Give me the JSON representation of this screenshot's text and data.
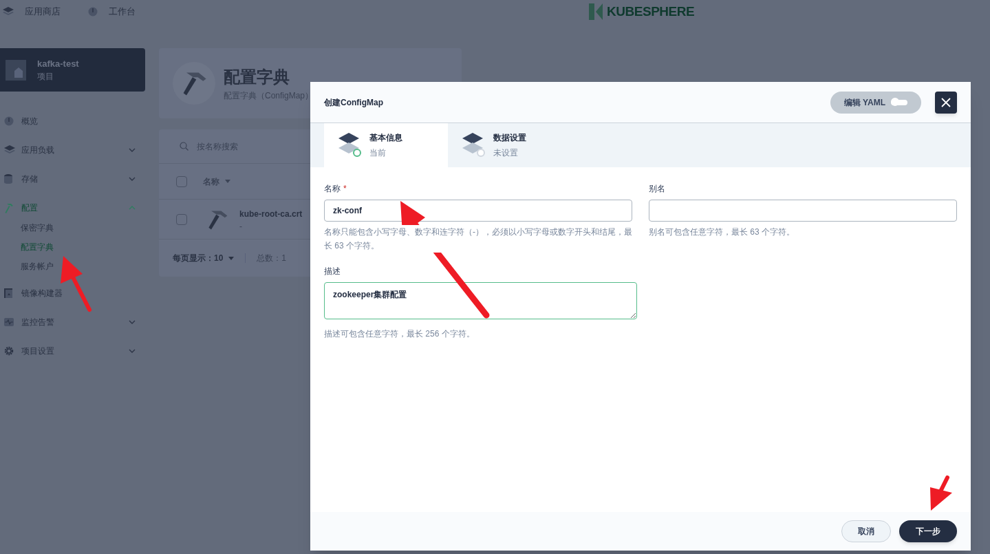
{
  "top_nav": [
    {
      "label": "应用商店",
      "kind": "store"
    },
    {
      "label": "工作台",
      "kind": "dashboard"
    }
  ],
  "logo": {
    "text": "KUBESPHERE"
  },
  "sidebar": {
    "project": {
      "name": "kafka-test",
      "type": "项目"
    },
    "items": [
      {
        "label": "概览",
        "kind": "link",
        "selected": false
      },
      {
        "label": "应用负载",
        "kind": "group",
        "selected": false,
        "expanded": false
      },
      {
        "label": "存储",
        "kind": "group",
        "selected": false,
        "expanded": false
      },
      {
        "label": "配置",
        "kind": "group",
        "selected": true,
        "expanded": true,
        "children": [
          {
            "label": "保密字典",
            "selected": false
          },
          {
            "label": "配置字典",
            "selected": true
          },
          {
            "label": "服务帐户",
            "selected": false
          }
        ]
      },
      {
        "label": "镜像构建器",
        "kind": "link",
        "selected": false
      },
      {
        "label": "监控告警",
        "kind": "group",
        "selected": false,
        "expanded": false
      },
      {
        "label": "项目设置",
        "kind": "group",
        "selected": false,
        "expanded": false
      }
    ]
  },
  "page_header": {
    "title": "配置字典",
    "subtitle": "配置字典（ConfigMap）"
  },
  "search": {
    "placeholder": "按名称搜索"
  },
  "table": {
    "select_all": {
      "checked": false
    },
    "columns": [
      {
        "label": "名称"
      }
    ],
    "rows": [
      {
        "name": "kube-root-ca.crt",
        "description": "-",
        "checked": false
      }
    ]
  },
  "pagination": {
    "per_page_label": "每页显示：",
    "per_page": "10",
    "total": "总数：1"
  },
  "modal": {
    "title": "创建ConfigMap",
    "yaml_toggle": {
      "label": "编辑 YAML",
      "on": false
    },
    "steps": [
      {
        "title": "基本信息",
        "status": "当前",
        "selected": true
      },
      {
        "title": "数据设置",
        "status": "未设置",
        "selected": false
      }
    ],
    "fields": {
      "name": {
        "label": "名称",
        "required_mark": "*",
        "value": "zk-conf",
        "hint": "名称只能包含小写字母、数字和连字符（-），必须以小写字母或数字开头和结尾，最长 63 个字符。"
      },
      "alias": {
        "label": "别名",
        "hint": "别名可包含任意字符，最长 63 个字符。"
      },
      "description": {
        "label": "描述",
        "value": "zookeeper集群配置",
        "hint": "描述可包含任意字符，最长 256 个字符。"
      }
    },
    "buttons": {
      "cancel": "取消",
      "next": "下一步"
    }
  }
}
